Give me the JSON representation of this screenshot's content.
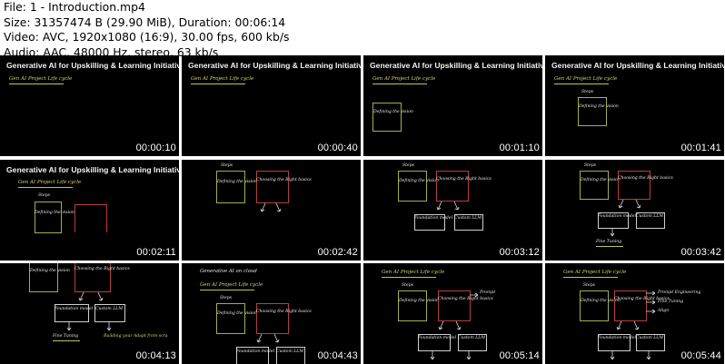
{
  "file_info": {
    "file": "File: 1 - Introduction.mp4",
    "size": "Size: 31357474 B (29.90 MiB), Duration: 00:06:14",
    "video": "Video: AVC, 1920x1080 (16:9), 30.00 fps, 600 kb/s",
    "audio": "Audio: AAC, 48000 Hz, stereo, 63 kb/s"
  },
  "slide_title": "Generative AI for Upskilling & Learning Initiatives",
  "hand": {
    "gen_ai": "Gen AI Project Life cycle",
    "gen_ai_cloud": "Generative AI on cloud",
    "steps": "Steps",
    "defining": "Defining the vision",
    "choosing": "Choosing the Right basics",
    "foundation": "Foundation model",
    "custom": "Custom LLM",
    "fine_tuning": "Fine Tuning",
    "building": "Building your Adapt from scra",
    "prompt": "Prompt",
    "prompt_eng": "Prompt Engineering",
    "fine_tuning_short": "Fine Tuning",
    "align": "Align"
  },
  "thumbnails": [
    {
      "time": "00:00:10"
    },
    {
      "time": "00:00:40"
    },
    {
      "time": "00:01:10"
    },
    {
      "time": "00:01:41"
    },
    {
      "time": "00:02:11"
    },
    {
      "time": "00:02:42"
    },
    {
      "time": "00:03:12"
    },
    {
      "time": "00:03:42"
    },
    {
      "time": "00:04:13"
    },
    {
      "time": "00:04:43"
    },
    {
      "time": "00:05:14"
    },
    {
      "time": "00:05:44"
    }
  ]
}
